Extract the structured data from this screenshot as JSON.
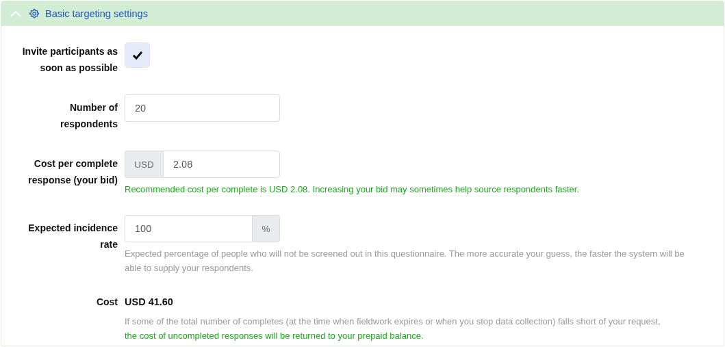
{
  "panel": {
    "title": "Basic targeting settings",
    "expanded": true
  },
  "fields": [
    {
      "kind": "checkbox",
      "label": "Invite participants as soon as possible",
      "checked": true
    },
    {
      "kind": "text",
      "label": "Number of respondents",
      "value": "20"
    },
    {
      "kind": "prefixed",
      "label": "Cost per complete response (your bid)",
      "addon": "USD",
      "value": "2.08",
      "help": [
        {
          "kind": "success",
          "text": "Recommended cost per complete is USD 2.08. Increasing your bid may sometimes help source respondents faster."
        }
      ]
    },
    {
      "kind": "suffixed",
      "label": "Expected incidence rate",
      "addon": "%",
      "value": "100",
      "help": [
        {
          "kind": "muted",
          "text": "Expected percentage of people who will not be screened out in this questionnaire. The more accurate your guess, the faster the system will be able to supply your respondents."
        }
      ]
    },
    {
      "kind": "cost",
      "label": "Cost",
      "value": "USD 41.60",
      "help": [
        {
          "kind": "muted",
          "text": "If some of the total number of completes (at the time when fieldwork expires or when you stop data collection) falls short of your request,"
        },
        {
          "kind": "success",
          "text": "the cost of uncompleted responses will be returned to your prepaid balance."
        }
      ]
    }
  ]
}
